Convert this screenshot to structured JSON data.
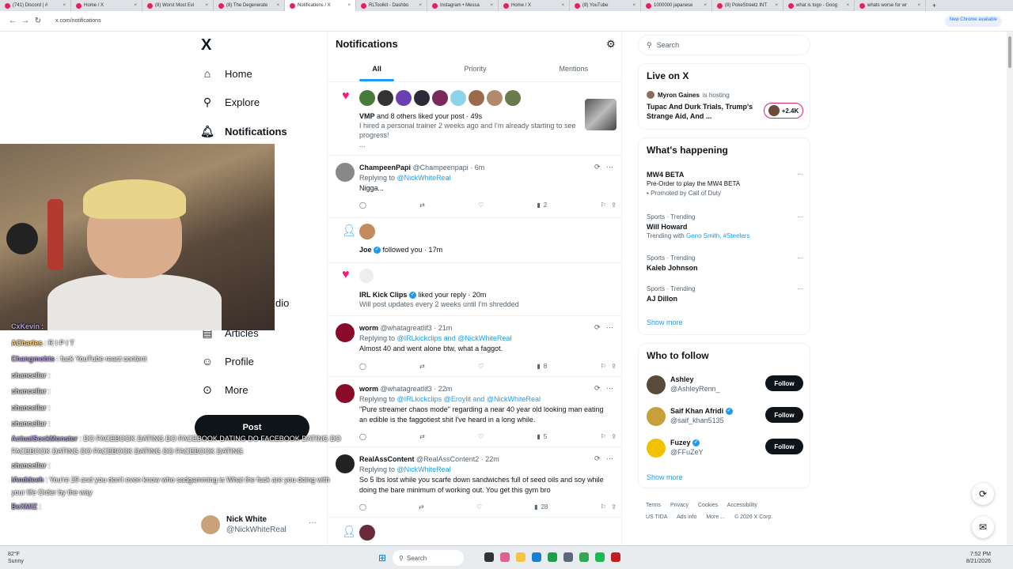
{
  "browser": {
    "tabs": [
      {
        "title": "(741) Discord | #",
        "active": false
      },
      {
        "title": "Home / X",
        "active": false
      },
      {
        "title": "(8) Worst Most Evi",
        "active": false
      },
      {
        "title": "(8) The Degenerate",
        "active": false
      },
      {
        "title": "Notifications / X",
        "active": true
      },
      {
        "title": "RLToolkit - Dashbo",
        "active": false
      },
      {
        "title": "Instagram • Messa",
        "active": false
      },
      {
        "title": "Home / X",
        "active": false
      },
      {
        "title": "(8) YouTube",
        "active": false
      },
      {
        "title": "1000000 japanese",
        "active": false
      },
      {
        "title": "(8) PokeStreetz INT",
        "active": false
      },
      {
        "title": "what is togo - Goog",
        "active": false
      },
      {
        "title": "whats worse for wr",
        "active": false
      }
    ],
    "new_tab": "+",
    "url": "x.com/notifications",
    "new_chrome": "New Chrome available"
  },
  "sidebar": {
    "logo": "X",
    "items": [
      {
        "label": "Home",
        "icon": "home-icon"
      },
      {
        "label": "Explore",
        "icon": "search-icon"
      },
      {
        "label": "Notifications",
        "icon": "bell-icon"
      },
      {
        "label": "dio",
        "icon": ""
      },
      {
        "label": "Articles",
        "icon": "article-icon"
      },
      {
        "label": "Profile",
        "icon": "person-icon"
      },
      {
        "label": "More",
        "icon": "more-icon"
      }
    ],
    "post_label": "Post",
    "account": {
      "name": "Nick White",
      "handle": "@NickWhiteReal",
      "dots": "···"
    }
  },
  "main": {
    "title": "Notifications",
    "tabs": [
      "All",
      "Priority",
      "Mentions"
    ],
    "notifications": [
      {
        "type": "like",
        "text_bold": "VMP",
        "text": " and 8 others liked your post · 49s",
        "body": "I hired a personal trainer 2 weeks ago and I'm already starting to see progress!",
        "more": "..."
      },
      {
        "type": "tweet",
        "name": "ChampeenPapi",
        "handle": "@Champeenpapi · 6m",
        "replying_prefix": "Replying to ",
        "replying": "@NickWhiteReal",
        "body": "Nigga...",
        "views": "2"
      },
      {
        "type": "follow",
        "text_bold": "Joe",
        "text": " followed you · 17m"
      },
      {
        "type": "like",
        "text_bold": "IRL Kick Clips",
        "text": " liked your reply · 20m",
        "body": "Will post updates every 2 weeks until I'm shredded"
      },
      {
        "type": "tweet",
        "name": "worm",
        "handle": "@whatagreatlif3 · 21m",
        "replying_prefix": "Replying to ",
        "replying": "@IRLkickclips and @NickWhiteReal",
        "body": "Almost 40 and went alone btw, what a faggot.",
        "views": "8"
      },
      {
        "type": "tweet",
        "name": "worm",
        "handle": "@whatagreatlif3 · 22m",
        "replying_prefix": "Replying to ",
        "replying": "@IRLkickclips @Eroylit and @NickWhiteReal",
        "body": "\"Pure streamer chaos mode\" regarding a near 40 year old looking man eating an edible is the faggotiest shit I've heard in a long while.",
        "views": "5"
      },
      {
        "type": "tweet",
        "name": "RealAssContent",
        "handle": "@RealAssContent2 · 22m",
        "replying_prefix": "Replying to ",
        "replying": "@NickWhiteReal",
        "body": "So 5 lbs lost while you scarfe down sandwiches full of seed oils and soy while doing the bare minimum of working out. You get this gym bro",
        "views": "28"
      }
    ]
  },
  "right": {
    "search_placeholder": "Search",
    "live": {
      "title": "Live on X",
      "host": "Myron Gaines",
      "host_suffix": " is hosting",
      "space": "Tupac And Durk Trials, Trump's Strange Aid, And ...",
      "count": "+2.4K"
    },
    "happening": {
      "title": "What's happening",
      "trends": [
        {
          "cat": "",
          "title": "MW4 BETA",
          "sub": "Pre-Order to play the MW4 BETA",
          "promo": "Promoted by Call of Duty"
        },
        {
          "cat": "Sports · Trending",
          "title": "Will Howard",
          "sub_prefix": "Trending with ",
          "sub_links": "Geno Smith, #Steelers"
        },
        {
          "cat": "Sports · Trending",
          "title": "Kaleb Johnson"
        },
        {
          "cat": "Sports · Trending",
          "title": "AJ Dillon"
        }
      ],
      "show_more": "Show more"
    },
    "who_to_follow": {
      "title": "Who to follow",
      "people": [
        {
          "name": "Ashley",
          "handle": "@AshleyRenn_",
          "button": "Follow"
        },
        {
          "name": "Saif Khan Afridi",
          "handle": "@saif_khan5135",
          "button": "Follow"
        },
        {
          "name": "Fuzey",
          "handle": "@FFuZeY",
          "button": "Follow"
        }
      ],
      "show_more": "Show more"
    },
    "footer": [
      "Terms",
      "Privacy",
      "Cookies",
      "Accessibility",
      "US TIDA",
      "Ads info",
      "More ...",
      "© 2026 X Corp."
    ]
  },
  "chat": [
    {
      "user": "CxKevin",
      "msg": "",
      "cls": ""
    },
    {
      "user": "ACharles",
      "msg": "R I P I T",
      "cls": "o"
    },
    {
      "user": "Changmobts",
      "msg": "fuck YouTube react content",
      "cls": ""
    },
    {
      "user": "chancellar",
      "msg": "",
      "cls": "w"
    },
    {
      "user": "chancellar",
      "msg": "",
      "cls": "w"
    },
    {
      "user": "chancellar",
      "msg": "",
      "cls": "w"
    },
    {
      "user": "chancellar",
      "msg": "",
      "cls": "w"
    },
    {
      "user": "ActualSockMonster",
      "msg": "DO FACEBOOK DATING   DO FACEBOOK DATING   DO FACEBOOK DATING   DO FACEBOOK DATING   DO FACEBOOK DATING   DO FACEBOOK DATING",
      "cls": ""
    },
    {
      "user": "chancellar",
      "msg": "",
      "cls": "w"
    },
    {
      "user": "iAnddeeh",
      "msg": "You're 29 and you don't even know who sadgamming is What the fuck are you doing with your life Order by the way",
      "cls": ""
    },
    {
      "user": "BeXMIZ",
      "msg": "",
      "cls": ""
    }
  ],
  "taskbar": {
    "weather_temp": "82°F",
    "weather_desc": "Sunny",
    "search": "Search",
    "time": "7:52 PM",
    "date": "8/21/2026"
  }
}
